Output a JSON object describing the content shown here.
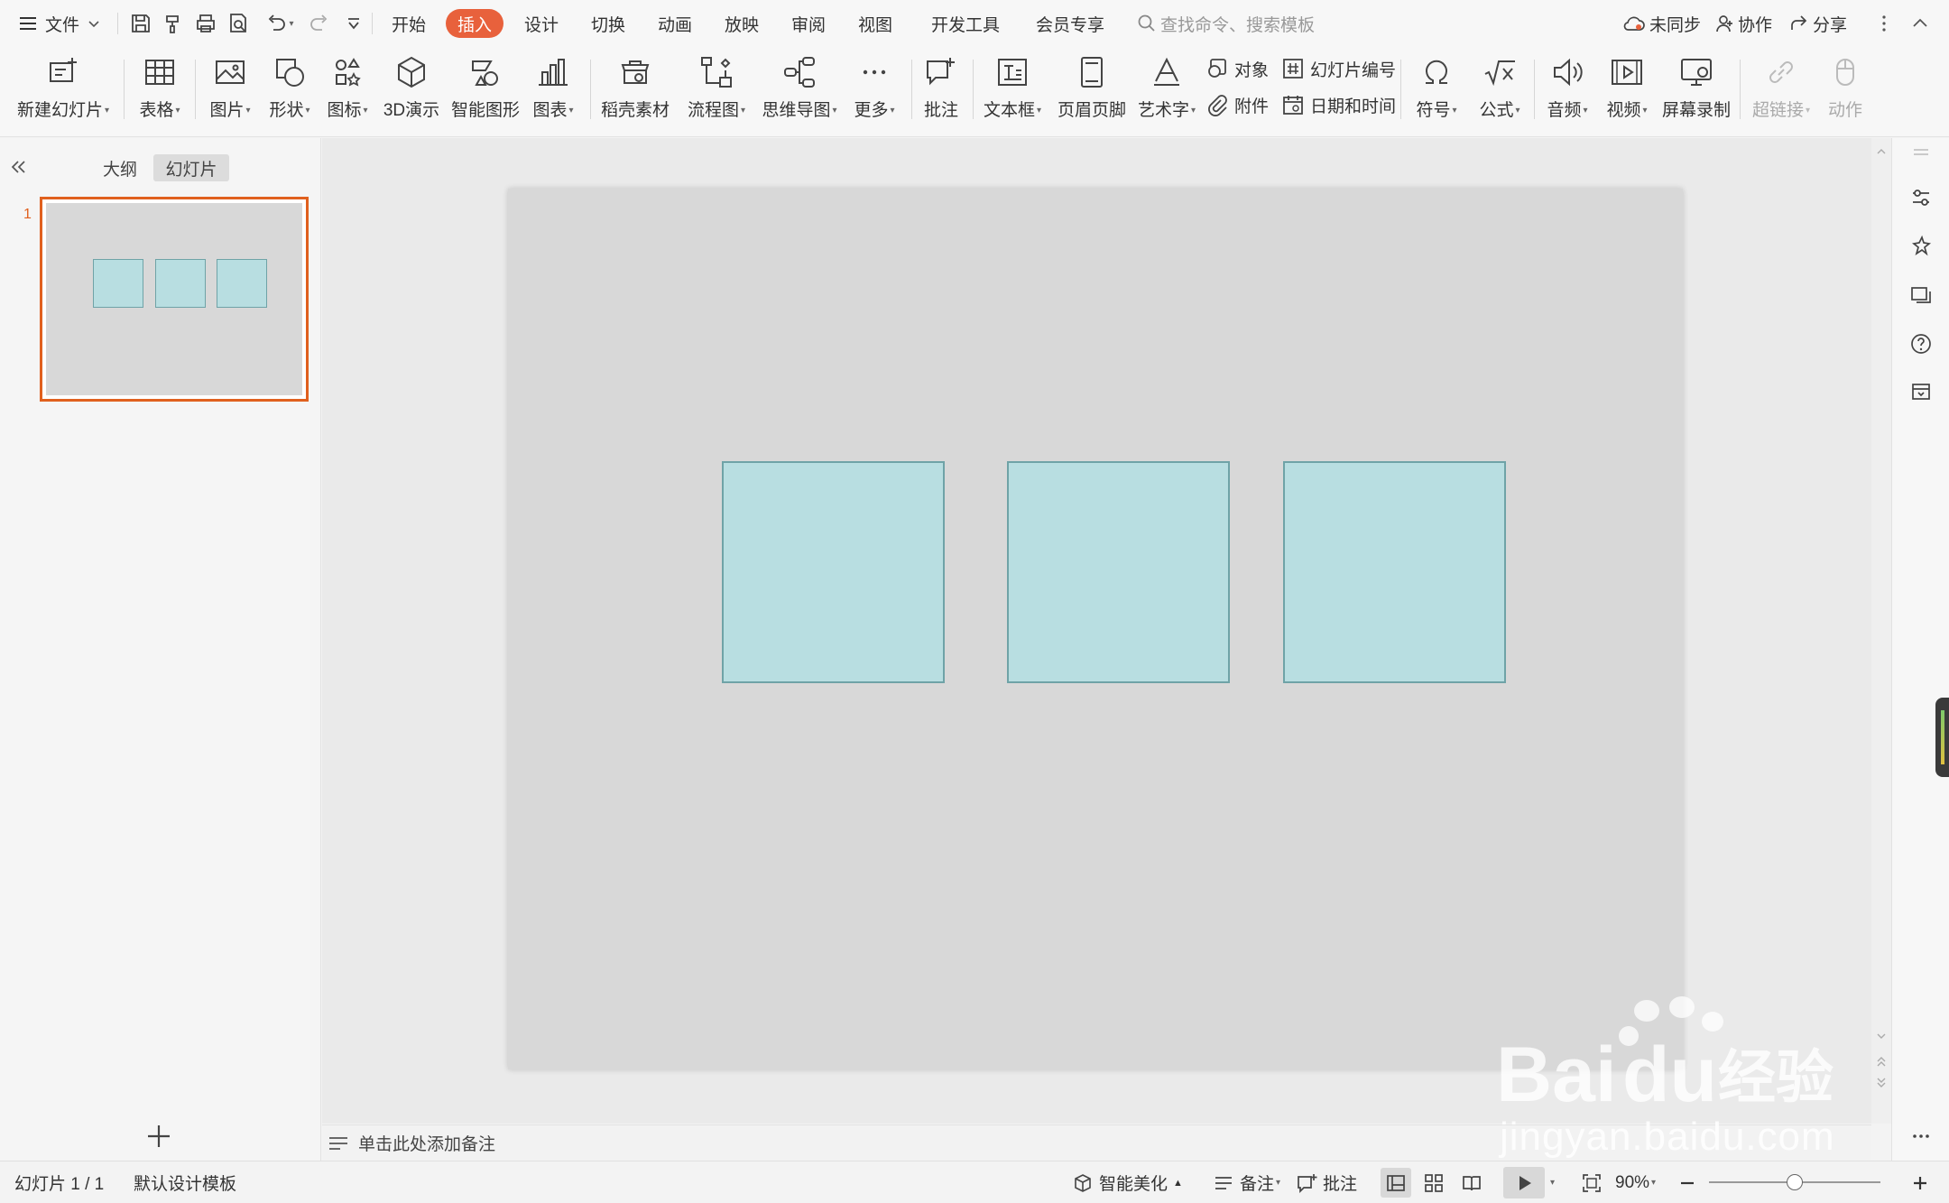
{
  "menubar": {
    "file_label": "文件",
    "tabs": [
      {
        "label": "开始"
      },
      {
        "label": "插入",
        "active": true
      },
      {
        "label": "设计"
      },
      {
        "label": "切换"
      },
      {
        "label": "动画"
      },
      {
        "label": "放映"
      },
      {
        "label": "审阅"
      },
      {
        "label": "视图"
      },
      {
        "label": "开发工具"
      },
      {
        "label": "会员专享"
      }
    ],
    "search_placeholder": "查找命令、搜索模板",
    "sync_label": "未同步",
    "collab_label": "协作",
    "share_label": "分享"
  },
  "ribbon": {
    "new_slide": "新建幻灯片",
    "table": "表格",
    "picture": "图片",
    "shape": "形状",
    "icon": "图标",
    "demo3d": "3D演示",
    "smartart": "智能图形",
    "chart": "图表",
    "material": "稻壳素材",
    "flowchart": "流程图",
    "mindmap": "思维导图",
    "more": "更多",
    "comment": "批注",
    "textbox": "文本框",
    "header_footer": "页眉页脚",
    "wordart": "艺术字",
    "object": "对象",
    "attachment": "附件",
    "slide_number": "幻灯片编号",
    "datetime": "日期和时间",
    "symbol": "符号",
    "formula": "公式",
    "audio": "音频",
    "video": "视频",
    "screen_record": "屏幕录制",
    "hyperlink": "超链接",
    "action": "动作"
  },
  "leftpanel": {
    "tab_outline": "大纲",
    "tab_slides": "幻灯片",
    "slide_number": "1"
  },
  "notes": {
    "placeholder": "单击此处添加备注"
  },
  "statusbar": {
    "slide_info": "幻灯片 1 / 1",
    "template": "默认设计模板",
    "beautify": "智能美化",
    "notes": "备注",
    "comment": "批注",
    "zoom": "90%",
    "zoom_level": 0.5
  },
  "colors": {
    "accent": "#e8613c",
    "shape_fill": "#b8dee1",
    "shape_border": "#6fa3a7",
    "slide_bg": "#d8d8d8"
  },
  "watermark": {
    "text": "jingyan.baidu.com"
  }
}
